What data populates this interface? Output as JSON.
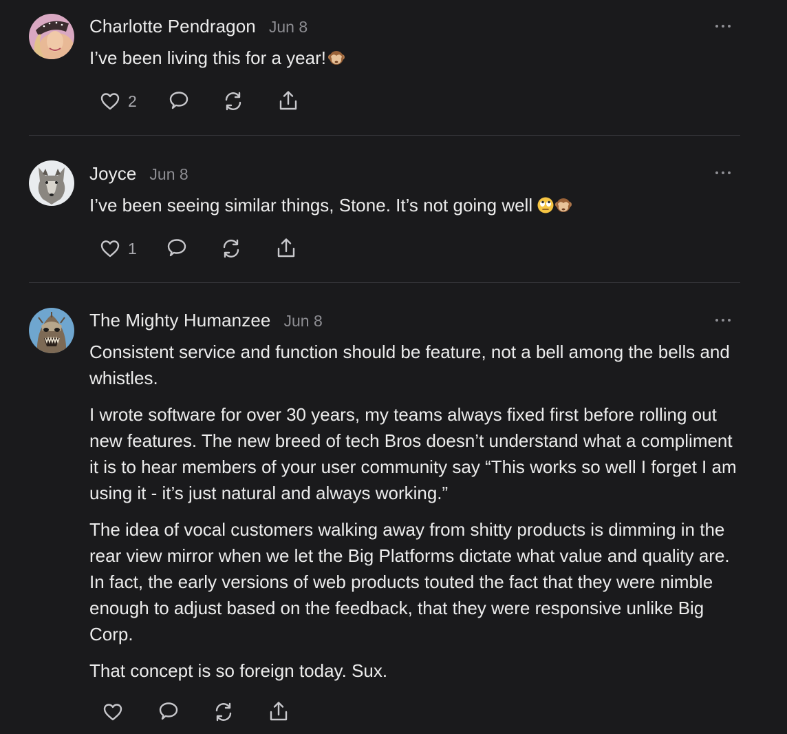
{
  "comments": [
    {
      "author": "Charlotte Pendragon",
      "date": "Jun 8",
      "paragraphs": [
        "I’ve been living this for a year!"
      ],
      "emoji": [
        "see-no-evil-monkey"
      ],
      "likes": "2",
      "avatar": "avatar-woman-hat"
    },
    {
      "author": "Joyce",
      "date": "Jun 8",
      "paragraphs": [
        "I’ve been seeing similar things, Stone. It’s not going well"
      ],
      "emoji": [
        "eye-roll-face",
        "see-no-evil-monkey"
      ],
      "likes": "1",
      "avatar": "avatar-wolf"
    },
    {
      "author": "The Mighty Humanzee",
      "date": "Jun 8",
      "paragraphs": [
        "Consistent service and function should be feature, not a bell among the bells and whistles.",
        "I wrote software for over 30 years, my teams always fixed first before rolling out new features. The new breed of tech Bros doesn’t understand what a compliment it is to hear members of your user community say “This works so well I forget I am using it - it’s just natural and always working.”",
        "The idea of vocal customers walking away from shitty products is dimming in the rear view mirror when we let the Big Platforms dictate what value and quality are. In fact, the early versions of web products touted the fact that they were nimble enough to adjust based on the feedback, that they were responsive unlike Big Corp.",
        "That concept is so foreign today. Sux."
      ],
      "emoji": [],
      "likes": "",
      "avatar": "avatar-creature"
    }
  ],
  "colors": {
    "background": "#1a1a1c",
    "text": "#ececec",
    "muted": "#8e8e93",
    "divider": "#38383c"
  },
  "icons": [
    "heart-icon",
    "comment-icon",
    "restack-icon",
    "share-icon",
    "more-icon"
  ]
}
